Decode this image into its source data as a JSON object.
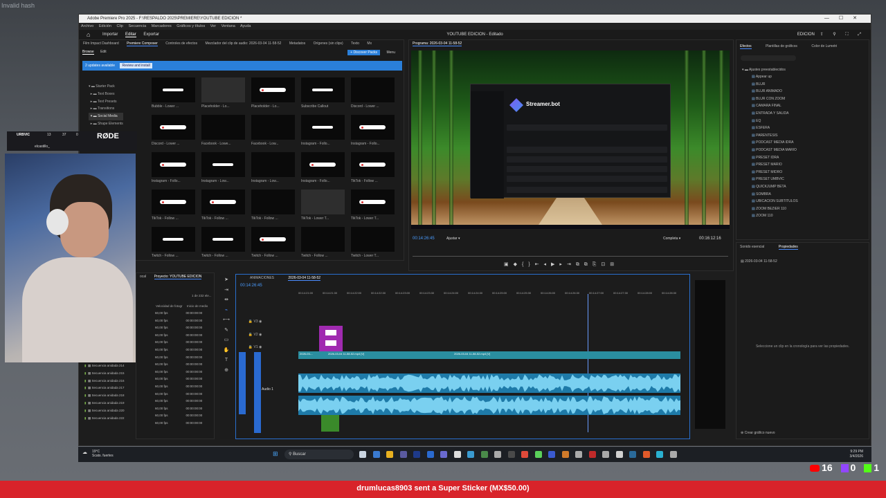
{
  "desktop": {
    "error_text": "Invalid hash"
  },
  "window": {
    "title": "Adobe Premiere Pro 2025 - F:\\RESPALDO 2025\\PREMIERE\\YOUTUBE EDICION *",
    "menu": [
      "Archivo",
      "Edición",
      "Clip",
      "Secuencia",
      "Marcadores",
      "Gráficos y títulos",
      "Ver",
      "Ventana",
      "Ayuda"
    ],
    "nav": [
      "Importar",
      "Editar",
      "Exportar"
    ],
    "project_title": "YOUTUBE EDICION - Editado",
    "workspace": "EDICION"
  },
  "left_panel": {
    "tabs": [
      "Film Impact Dashboard",
      "Premiere Composer",
      "Controles de efectos",
      "Mezclador del clip de audio: 2026-03-04 11-58-52",
      "Metadatos",
      "Orígenes (sin clips)",
      "Texto",
      "Mx"
    ],
    "sub_tabs": [
      "Browse",
      "Edit"
    ],
    "discover": "+ Discover Packs",
    "menu": "Menu",
    "update_text": "2 updates available",
    "review_btn": "Review and install",
    "tree": [
      "Starter Pack",
      "Text Boxes",
      "Text Presets",
      "Transitions",
      "Social Media",
      "Shape Elements"
    ],
    "items": [
      "Bubble - Lower ...",
      "Placeholder - Lo...",
      "Placeholder - Lo...",
      "Subscribe Callout",
      "Discord - Lower ...",
      "Discord - Lower ...",
      "Facebook - Lowe...",
      "Facebook - Low...",
      "Instagram - Follo...",
      "Instagram - Follo...",
      "Instagram - Follo...",
      "Instagram - Low...",
      "Instagram - Low...",
      "Instagram - Follo...",
      "TikTok - Follow ...",
      "TikTok - Follow ...",
      "TikTok - Follow ...",
      "TikTok - Follow ...",
      "TikTok - Lower T...",
      "TikTok - Lower T...",
      "Twitch - Follow ...",
      "Twitch - Follow ...",
      "Twitch - Follow ...",
      "Twitch - Follow ...",
      "Twitch - Lower T..."
    ]
  },
  "program": {
    "tab": "Programa: 2026-03-04 11-58-52",
    "timecode": "00:14:26:45",
    "fit": "Ajustar",
    "quality": "Completa",
    "duration": "00:16:12:16",
    "app_in_video": "Streamer.bot"
  },
  "effects": {
    "tabs": [
      "Efectos",
      "Plantillas de gráficos",
      "Color de Lumetri"
    ],
    "folder": "Ajustes preestablecidos",
    "presets": [
      "Appear up",
      "BLUR",
      "BLUR ANIMADO",
      "BLUR CON ZOOM",
      "CAMARA FINAL",
      "ENTRADA Y SALIDA",
      "EQ",
      "ESFERA",
      "PARENTESIS",
      "PODCAST MEDIA IDRA",
      "PODCAST MEDIA MARIO",
      "PRESET IDRA",
      "PRESET MARIO",
      "PRESET MIDRO",
      "PRESET UMBVIC",
      "QUICKJUMP BETA",
      "SOMBRA",
      "UBICACION SUBTITULOS",
      "ZOOM BEZIER 110",
      "ZOOM 110"
    ]
  },
  "properties": {
    "tabs": [
      "Sonido esencial",
      "Propiedades"
    ],
    "clip": "2026-03-04 11-58-52",
    "empty_msg": "Seleccione un clip en la cronología para ver las propiedades.",
    "create_btn": "Crear gráfico nuevo"
  },
  "project": {
    "tabs": [
      "ocal",
      "Proyecto: YOUTUBE EDICION"
    ],
    "count": "1 de 232 ele...",
    "cols": [
      "Velocidad de fotogr",
      "Inicio de medio"
    ],
    "fps": "60,00 fps",
    "tc": "00:00:00:00",
    "sequences": [
      "Secuencia anidada 214",
      "Secuencia anidada 215",
      "Secuencia anidada 216",
      "Secuencia anidada 217",
      "Secuencia anidada 218",
      "Secuencia anidada 219",
      "Secuencia anidada 220",
      "Secuencia anidada 222"
    ]
  },
  "timeline": {
    "tabs": [
      "ANIMACIONES",
      "2026-03-04 11-58-52"
    ],
    "timecode": "00:14:26:45",
    "ruler": [
      "00:14:21:00",
      "00:14:21:30",
      "00:14:22:00",
      "00:14:22:30",
      "00:14:23:00",
      "00:14:23:30",
      "00:14:24:00",
      "00:14:24:30",
      "00:14:25:00",
      "00:14:25:30",
      "00:14:26:00",
      "00:14:26:30",
      "00:14:27:00",
      "00:14:27:30",
      "00:14:28:00",
      "00:14:28:30"
    ],
    "tracks": [
      "V3",
      "V2",
      "V1",
      "A1"
    ],
    "audio_label": "Audio 1",
    "clip1": "2026-03-...",
    "clip2": "2026-03-04 11-58-52.mp4 [V]",
    "clip3": "2026-03-04 11-58-52.mp4 [V]"
  },
  "webcam_overlay": {
    "user": "URBVIC",
    "n1": "13",
    "n2": "37",
    "n3": "0",
    "brand": "RØDE",
    "handle": "elcastillo_"
  },
  "taskbar": {
    "weather": "19°C",
    "weather_sub": "Scats. fuertes",
    "search": "Buscar",
    "time": "9:29 PM",
    "date": "3/4/2026"
  },
  "stream": {
    "youtube": "16",
    "twitch": "0",
    "kick": "1",
    "alert": "drumlucas8903 sent a Super Sticker (MX$50.00)"
  }
}
